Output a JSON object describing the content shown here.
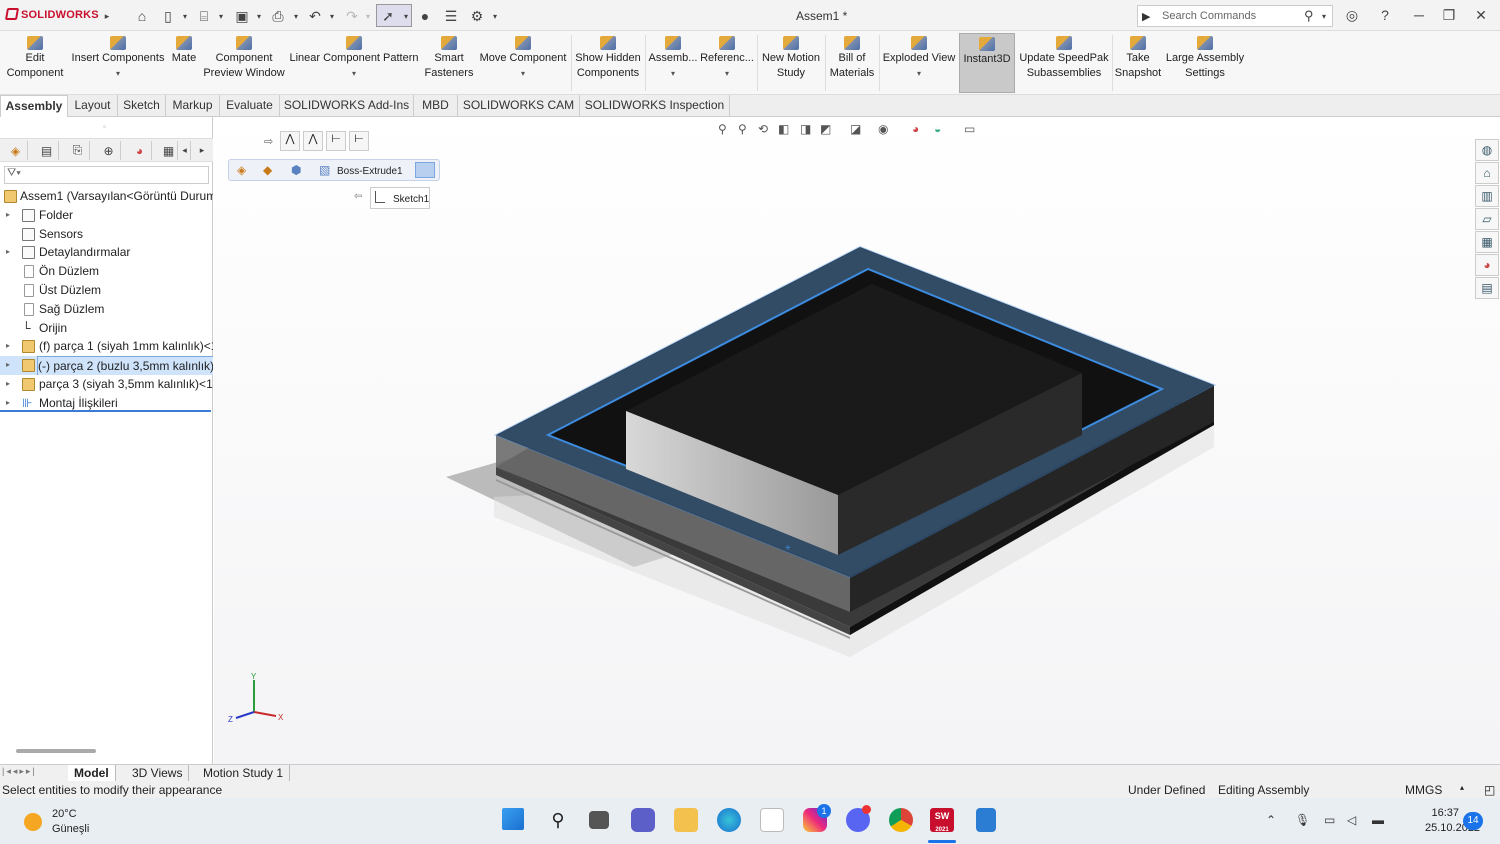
{
  "app": {
    "brand": "SOLIDWORKS",
    "window_title": "Assem1 *"
  },
  "search": {
    "placeholder": "Search Commands"
  },
  "ribbon": {
    "buttons": [
      {
        "label": "Edit Component"
      },
      {
        "label": "Insert Components"
      },
      {
        "label": "Mate"
      },
      {
        "label": "Component Preview Window"
      },
      {
        "label": "Linear Component Pattern"
      },
      {
        "label": "Smart Fasteners"
      },
      {
        "label": "Move Component"
      },
      {
        "label": "Show Hidden Components"
      },
      {
        "label": "Assemb..."
      },
      {
        "label": "Referenc..."
      },
      {
        "label": "New Motion Study"
      },
      {
        "label": "Bill of Materials"
      },
      {
        "label": "Exploded View"
      },
      {
        "label": "Instant3D"
      },
      {
        "label": "Update SpeedPak Subassemblies"
      },
      {
        "label": "Take Snapshot"
      },
      {
        "label": "Large Assembly Settings"
      }
    ]
  },
  "tabs": [
    "Assembly",
    "Layout",
    "Sketch",
    "Markup",
    "Evaluate",
    "SOLIDWORKS Add-Ins",
    "MBD",
    "SOLIDWORKS CAM",
    "SOLIDWORKS Inspection"
  ],
  "tree": {
    "root": "Assem1  (Varsayılan<Görüntü Durum",
    "items": [
      {
        "label": "Folder"
      },
      {
        "label": "Sensors"
      },
      {
        "label": "Detaylandırmalar"
      },
      {
        "label": "Ön Düzlem"
      },
      {
        "label": "Üst Düzlem"
      },
      {
        "label": "Sağ Düzlem"
      },
      {
        "label": "Orijin"
      },
      {
        "label": "(f) parça 1 (siyah 1mm kalınlık)<1"
      },
      {
        "label": "(-) parça 2 (buzlu 3,5mm kalınlık)"
      },
      {
        "label": "parça 3 (siyah 3,5mm kalınlık)<1>"
      },
      {
        "label": "Montaj İlişkileri"
      }
    ]
  },
  "breadcrumb": {
    "feature": "Boss-Extrude1",
    "sketch": "Sketch1"
  },
  "triad": {
    "x": "X",
    "y": "Y",
    "z": "Z"
  },
  "bottom_tabs": [
    "Model",
    "3D Views",
    "Motion Study 1"
  ],
  "status": {
    "hint": "Select entities to modify their appearance",
    "defined": "Under Defined",
    "mode": "Editing Assembly",
    "units": "MMGS"
  },
  "taskbar": {
    "temperature": "20°C",
    "weather": "Güneşli",
    "time": "16:37",
    "date": "25.10.2022",
    "notifications": "14",
    "badge_instagram": "1",
    "solidworks_year": "2021"
  },
  "colors": {
    "selection_blue": "#3d8ce0",
    "brand_red": "#c8102e",
    "accent": "#1a73e8"
  }
}
